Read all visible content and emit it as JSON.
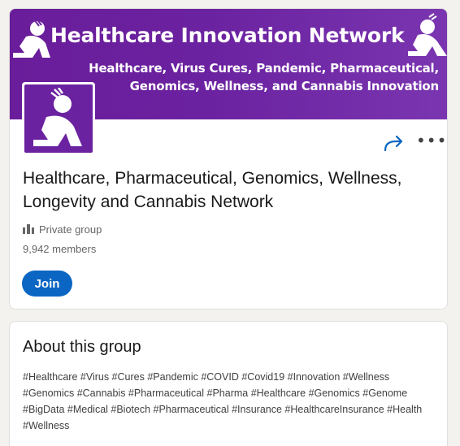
{
  "banner": {
    "title": "Healthcare Innovation Network",
    "subtitle_line1": "Healthcare, Virus Cures, Pandemic, Pharmaceutical,",
    "subtitle_line2": "Genomics, Wellness, and Cannabis Innovation",
    "logo_icon": "thinker-lightbulb-icon"
  },
  "group": {
    "name": "Healthcare, Pharmaceutical, Genomics, Wellness, Longevity and Cannabis Network",
    "privacy": "Private group",
    "privacy_icon": "group-icon",
    "members": "9,942 members",
    "join_label": "Join",
    "share_icon": "share-arrow-icon",
    "more_icon": "more-options-icon"
  },
  "about": {
    "title": "About this group",
    "description": "#Healthcare #Virus #Cures #Pandemic #COVID #Covid19 #Innovation #Wellness #Genomics #Cannabis #Pharmaceutical #Pharma #Healthcare #Genomics #Genome #BigData #Medical #Biotech #Pharmaceutical #Insurance #HealthcareInsurance #Health #Wellness"
  },
  "colors": {
    "banner_purple": "#6b22a0",
    "join_blue": "#0a66c2",
    "background": "#f4f2ee"
  }
}
